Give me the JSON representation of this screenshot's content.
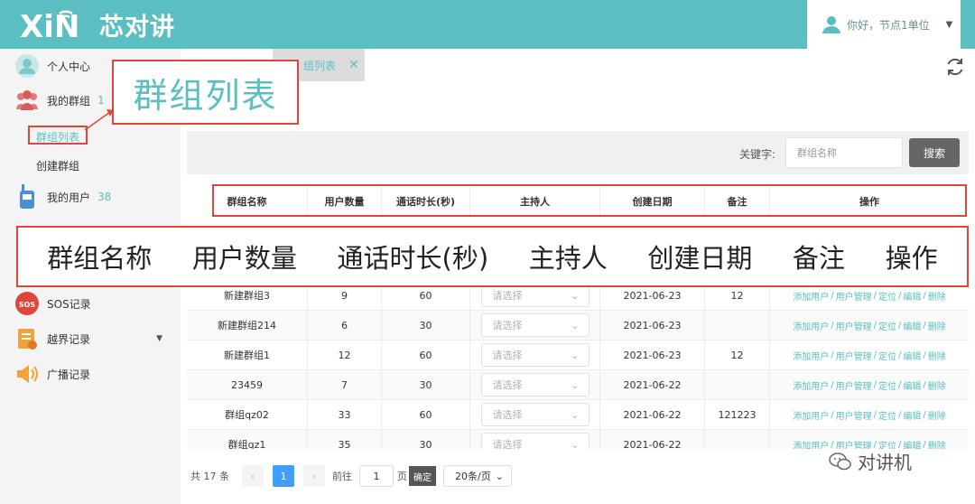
{
  "header": {
    "logo_latin": "XiN",
    "logo_cn": "芯对讲",
    "greeting": "你好，节点1单位",
    "colors": {
      "bar": "#5bbfc2",
      "accent": "#5bbfc2"
    }
  },
  "sidebar": {
    "items": [
      {
        "label": "个人中心",
        "icon": "user-avatar-icon"
      },
      {
        "label": "我的群组",
        "count": "1",
        "icon": "group-icon"
      },
      {
        "label": "群组列表",
        "sub": true,
        "active": true
      },
      {
        "label": "创建群组",
        "sub": true
      },
      {
        "label": "我的用户",
        "count": "38",
        "icon": "walkie-talkie-icon"
      },
      {
        "label": "SOS记录",
        "icon": "sos-icon"
      },
      {
        "label": "越界记录",
        "icon": "geofence-icon"
      },
      {
        "label": "广播记录",
        "icon": "broadcast-icon"
      }
    ]
  },
  "tab": {
    "label": "组列表",
    "close": "✕"
  },
  "search": {
    "keyword_label": "关键字:",
    "placeholder": "群组名称",
    "button": "搜索"
  },
  "table": {
    "columns": [
      "群组名称",
      "用户数量",
      "通话时长(秒)",
      "主持人",
      "创建日期",
      "备注",
      "操作"
    ],
    "select_placeholder": "请选择",
    "ops": [
      "添加用户",
      "用户管理",
      "定位",
      "编辑",
      "删除"
    ],
    "rows": [
      {
        "name": "新建群组3",
        "users": "9",
        "duration": "60",
        "date": "2021-06-23",
        "note": "12"
      },
      {
        "name": "新建群组214",
        "users": "6",
        "duration": "30",
        "date": "2021-06-23",
        "note": ""
      },
      {
        "name": "新建群组1",
        "users": "12",
        "duration": "60",
        "date": "2021-06-23",
        "note": "12"
      },
      {
        "name": "23459",
        "users": "7",
        "duration": "30",
        "date": "2021-06-22",
        "note": ""
      },
      {
        "name": "群组qz02",
        "users": "33",
        "duration": "60",
        "date": "2021-06-22",
        "note": "121223"
      },
      {
        "name": "群组qz1",
        "users": "35",
        "duration": "30",
        "date": "2021-06-22",
        "note": ""
      }
    ]
  },
  "pagination": {
    "total": "共 17 条",
    "prev": "‹",
    "page": "1",
    "next": "›",
    "goto_label": "前往",
    "goto_value": "1",
    "page_unit": "页",
    "confirm": "确定",
    "page_size": "20条/页"
  },
  "annotations": {
    "title": "群组列表",
    "banner": [
      "群组名称",
      "用户数量",
      "通话时长(秒)",
      "主持人",
      "创建日期",
      "备注",
      "操作"
    ],
    "watermark": "对讲机"
  }
}
